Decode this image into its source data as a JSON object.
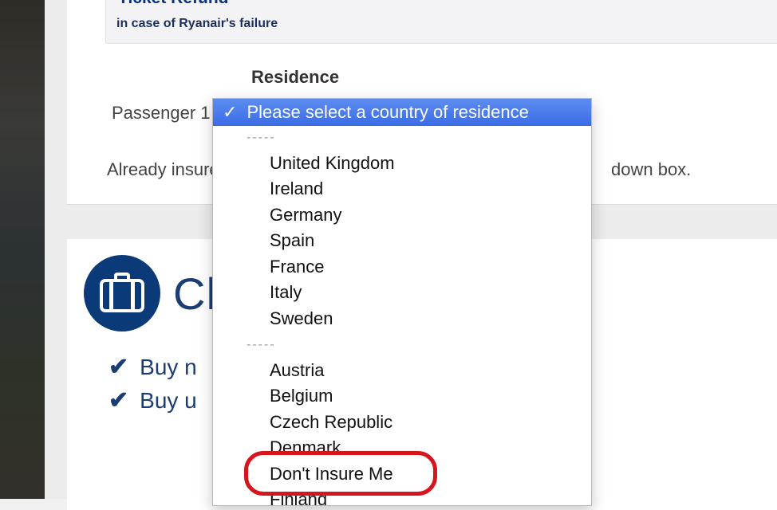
{
  "refund": {
    "title": "Ticket Refund",
    "subtitle": "in case of Ryanair's failure"
  },
  "form": {
    "residence_label": "Residence",
    "passenger_label": "Passenger 1",
    "already_insured_start": "Already insure",
    "already_insured_end": "down box."
  },
  "dropdown": {
    "selected": "Please select a country of residence",
    "separator": "-----",
    "group1": [
      "United Kingdom",
      "Ireland",
      "Germany",
      "Spain",
      "France",
      "Italy",
      "Sweden"
    ],
    "group2": [
      "Austria",
      "Belgium",
      "Czech Republic",
      "Denmark",
      "Don't Insure Me",
      "Finland"
    ]
  },
  "choose": {
    "title_fragment": "Ch",
    "bullets": [
      "Buy n",
      "Buy u"
    ]
  },
  "colors": {
    "brand_navy": "#0b3a78",
    "select_blue": "#3a6ce6",
    "highlight_red": "#d7151d"
  },
  "icons": {
    "suitcase": "suitcase-icon",
    "check": "checkmark-icon"
  }
}
